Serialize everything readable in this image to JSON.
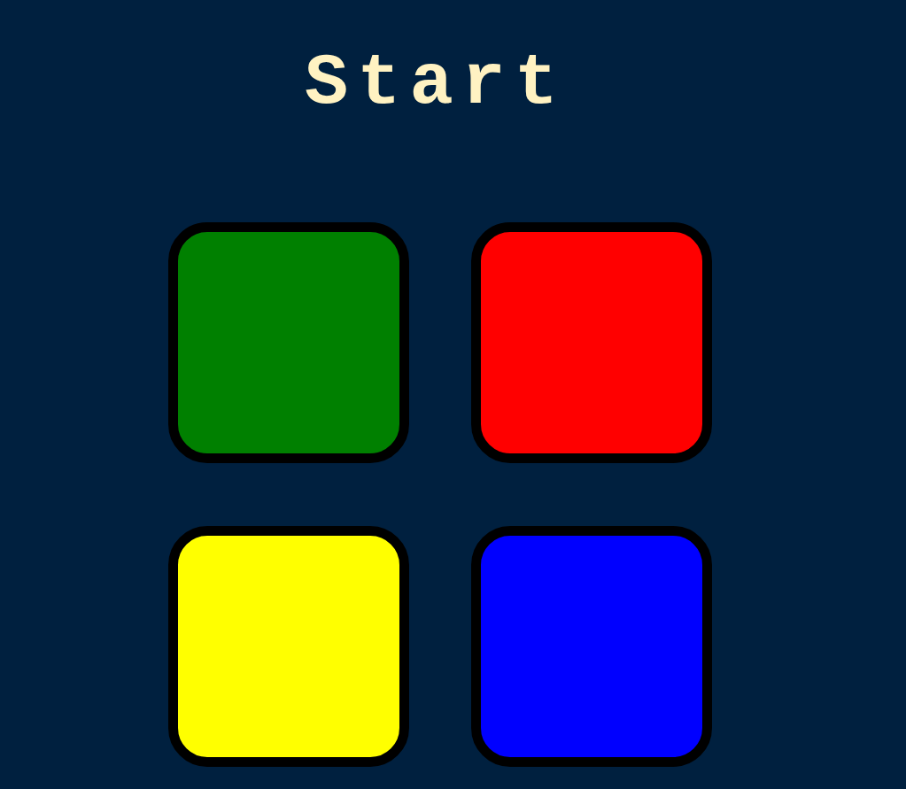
{
  "title": "Start",
  "pads": [
    {
      "color": "#008000"
    },
    {
      "color": "#ff0000"
    },
    {
      "color": "#ffff00"
    },
    {
      "color": "#0000ff"
    }
  ]
}
